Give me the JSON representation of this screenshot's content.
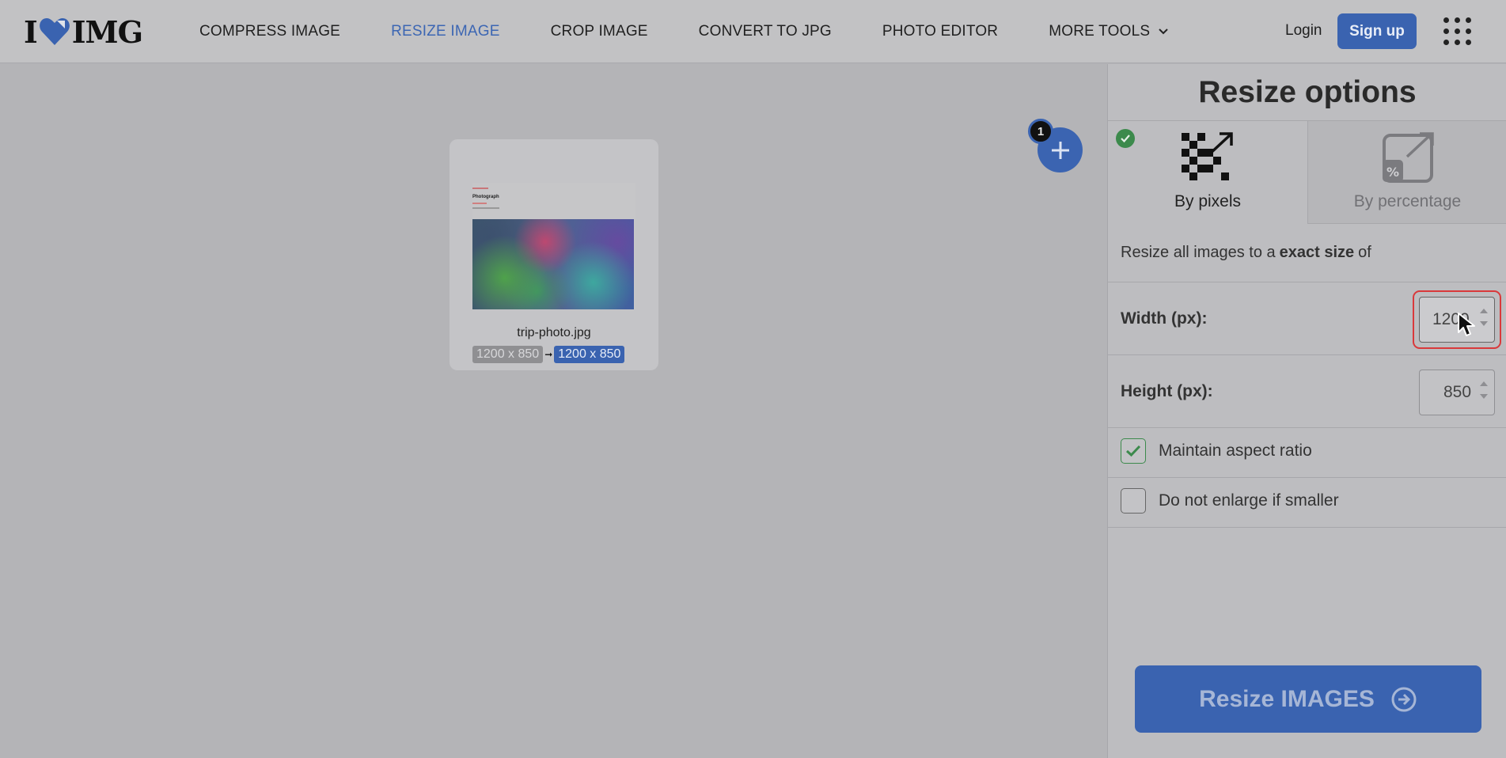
{
  "header": {
    "logo": {
      "left": "I",
      "right": "IMG"
    },
    "nav": [
      {
        "label": "COMPRESS IMAGE",
        "active": false
      },
      {
        "label": "RESIZE IMAGE",
        "active": true
      },
      {
        "label": "CROP IMAGE",
        "active": false
      },
      {
        "label": "CONVERT TO JPG",
        "active": false
      },
      {
        "label": "PHOTO EDITOR",
        "active": false
      },
      {
        "label": "MORE TOOLS",
        "active": false
      }
    ],
    "login": "Login",
    "signup": "Sign up",
    "apps_icon": "grid-icon"
  },
  "workspace": {
    "file": {
      "thumbnail_heading": "Photograph",
      "name": "trip-photo.jpg",
      "original_size": "1200 x 850",
      "arrow": "➞",
      "new_size": "1200 x 850"
    },
    "add_button_icon": "plus-icon",
    "file_count": "1"
  },
  "sidebar": {
    "title": "Resize options",
    "tabs": [
      {
        "label": "By pixels",
        "selected": true,
        "icon": "pixels-resize-icon"
      },
      {
        "label": "By percentage",
        "selected": false,
        "icon": "percentage-resize-icon"
      }
    ],
    "description": {
      "before": "Resize all images to a",
      "bold": "exact size",
      "after": "of"
    },
    "width": {
      "label": "Width (px):",
      "value": "1200"
    },
    "height": {
      "label": "Height (px):",
      "value": "850"
    },
    "maintain_aspect": {
      "label": "Maintain aspect ratio",
      "checked": true
    },
    "no_enlarge": {
      "label": "Do not enlarge if smaller",
      "checked": false
    },
    "submit": "Resize IMAGES"
  },
  "colors": {
    "accent": "#3a63b0",
    "success": "#3c8a4c",
    "focus": "#d9393b"
  }
}
